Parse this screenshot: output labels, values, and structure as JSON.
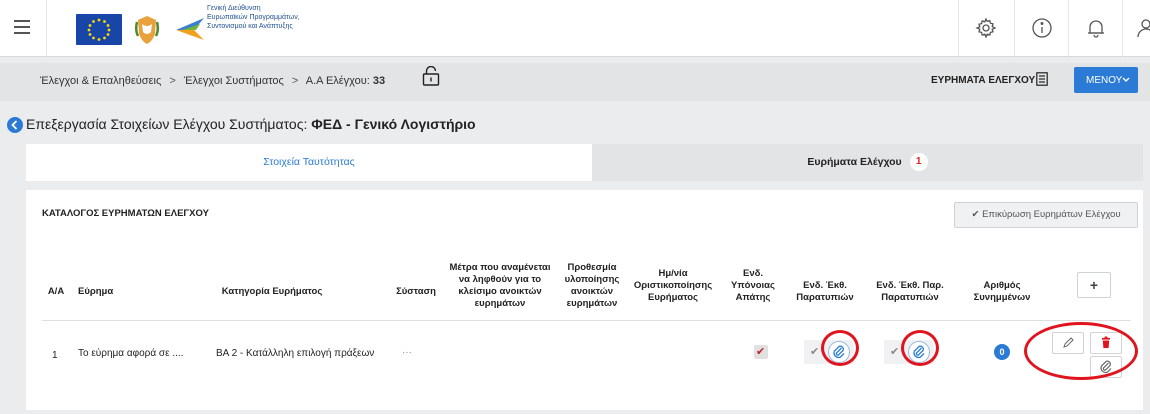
{
  "header": {
    "gov_text": [
      "Γενική Διεύθυνση",
      "Ευρωπαϊκών Προγραμμάτων,",
      "Συντονισμού και Ανάπτυξης"
    ],
    "icons": [
      "menu-icon",
      "settings-icon",
      "info-icon",
      "bell-icon",
      "user-icon"
    ]
  },
  "breadcrumb": {
    "item1": "Έλεγχοι & Επαληθεύσεις",
    "item2": "Έλεγχοι Συστήματος",
    "item3_label": "Α.Α Ελέγχου:",
    "item3_value": "33",
    "sep": ">"
  },
  "toolbar": {
    "findings_label": "ΕΥΡΗΜΑΤΑ ΕΛΕΓΧΟΥ",
    "menu_label": "ΜΕΝΟΥ"
  },
  "page": {
    "title_prefix": "Επεξεργασία Στοιχείων Ελέγχου Συστήματος:",
    "title_bold": "ΦΕΔ - Γενικό Λογιστήριο"
  },
  "tabs": [
    {
      "label": "Στοιχεία Ταυτότητας",
      "active": true
    },
    {
      "label": "Ευρήματα Ελέγχου",
      "badge": "1",
      "active": false
    }
  ],
  "panel": {
    "title": "ΚΑΤΑΛΟΓΟΣ ΕΥΡΗΜΑΤΩΝ ΕΛΕΓΧΟΥ",
    "validate_label": "Επικύρωση Ευρημάτων Ελέγχου",
    "add_label": "+"
  },
  "table": {
    "headers": {
      "aa": "Α/Α",
      "finding": "Εύρημα",
      "category": "Κατηγορία Ευρήματος",
      "recommendation": "Σύσταση",
      "measures": [
        "Μέτρα που αναμένεται",
        "να ληφθούν για το",
        "κλείσιμο ανοικτών",
        "ευρημάτων"
      ],
      "deadline": [
        "Προθεσμία",
        "υλοποίησης",
        "ανοικτών",
        "ευρημάτων"
      ],
      "final_date": [
        "Ημ/νία",
        "Οριστικοποίησης",
        "Ευρήματος"
      ],
      "fraud": [
        "Ενδ.",
        "Υπόνοιας",
        "Απάτης"
      ],
      "irreg_report": [
        "Ενδ. Έκθ.",
        "Παρατυπιών"
      ],
      "irreg_report_par": [
        "Ενδ. Έκθ. Παρ.",
        "Παρατυπιών"
      ],
      "attachments": [
        "Αριθμός",
        "Συνημμένων"
      ]
    },
    "rows": [
      {
        "aa": "1",
        "finding": "Το εύρημα αφορά σε ....",
        "category": "ΒΑ 2 - Κατάλληλη επιλογή πράξεων",
        "more": "···",
        "fraud_checked": true,
        "attachments_count": "0"
      }
    ]
  }
}
